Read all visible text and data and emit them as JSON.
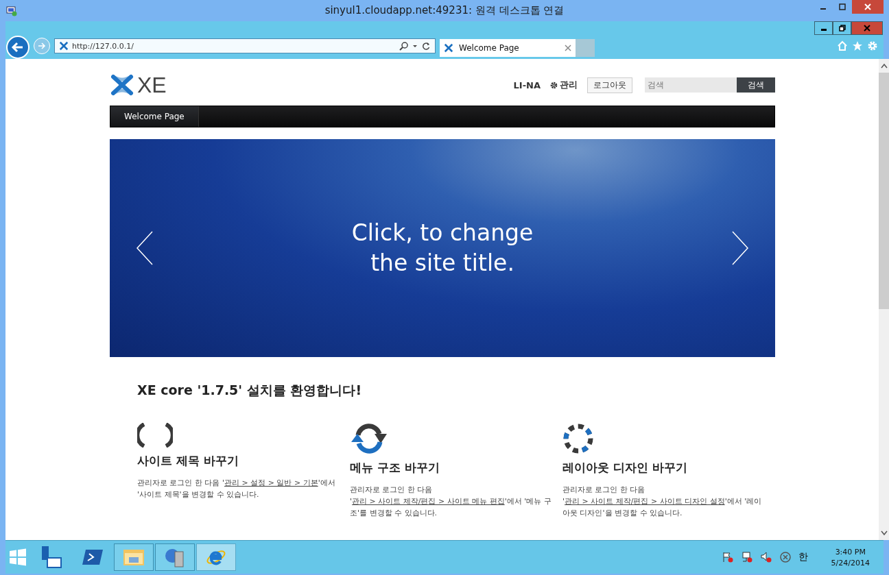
{
  "window": {
    "title": "sinyul1.cloudapp.net:49231: 원격 데스크톱 연결"
  },
  "browser": {
    "address": "http://127.0.0.1/",
    "tabs": [
      {
        "label": "Welcome Page",
        "selected": true
      }
    ]
  },
  "site": {
    "logo": "XE",
    "user": "LI-NA",
    "admin": "관리",
    "logout": "로그아웃",
    "search": {
      "placeholder": "검색",
      "button": "검색"
    },
    "menu": [
      {
        "label": "Welcome Page",
        "selected": true
      }
    ],
    "hero": {
      "title_lines": [
        "Click, to change",
        "the site title."
      ]
    },
    "welcome": "XE core '1.7.5' 설치를 환영합니다!",
    "features": [
      {
        "kind": "brackets",
        "title": "사이트 제목 바꾸기",
        "text": [
          {
            "text": "관리자로 로그인 한 다음 '",
            "link": false
          },
          {
            "text": "관리 > 설정 > 일반 > 기본",
            "link": true
          },
          {
            "text": "'에서 '사이트 제목'을 변경할 수 있습니다.",
            "link": false
          }
        ]
      },
      {
        "kind": "refresh",
        "title": "메뉴 구조 바꾸기",
        "text": [
          {
            "text": "관리자로 로그인 한 다음 '",
            "link": false
          },
          {
            "text": "관리 > 사이트 제작/편집 > 사이트 메뉴 편집",
            "link": true
          },
          {
            "text": "'에서 '메뉴 구조'를 변경할 수 있습니다.",
            "link": false
          }
        ]
      },
      {
        "kind": "dashed",
        "title": "레이아웃 디자인 바꾸기",
        "text": [
          {
            "text": "관리자로 로그인 한 다음 '",
            "link": false
          },
          {
            "text": "관리 > 사이트 제작/편집 > 사이트 디자인 설정",
            "link": true
          },
          {
            "text": "'에서 '레이아웃 디자인'을 변경할 수 있습니다.",
            "link": false
          }
        ]
      }
    ]
  },
  "taskbar": {
    "apps": [
      {
        "kind": "server-manager",
        "running": false,
        "selected": false
      },
      {
        "kind": "powershell",
        "running": false,
        "selected": false
      },
      {
        "kind": "explorer",
        "running": true,
        "selected": false
      },
      {
        "kind": "installer",
        "running": true,
        "selected": false
      },
      {
        "kind": "ie",
        "running": true,
        "selected": true
      }
    ],
    "ime": "한",
    "time": "3:40 PM",
    "date": "5/24/2014"
  }
}
